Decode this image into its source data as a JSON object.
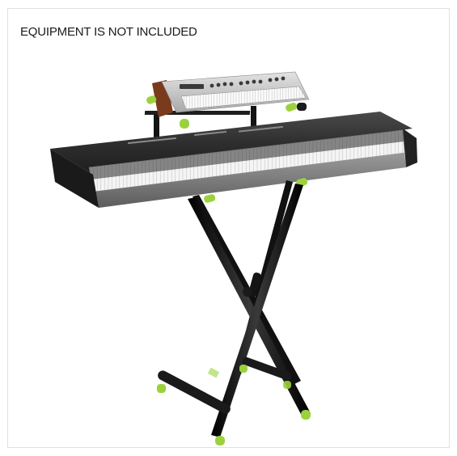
{
  "caption": "EQUIPMENT IS NOT INCLUDED",
  "product_image": {
    "icon": "keyboard-stand-photo",
    "accent_color": "#9bd23c",
    "frame_color": "#1b1b1b",
    "keyboard_body_color": "#3a3a3a",
    "synth_body_color": "#c9c9c9",
    "synth_side_color": "#7a3b1c"
  }
}
